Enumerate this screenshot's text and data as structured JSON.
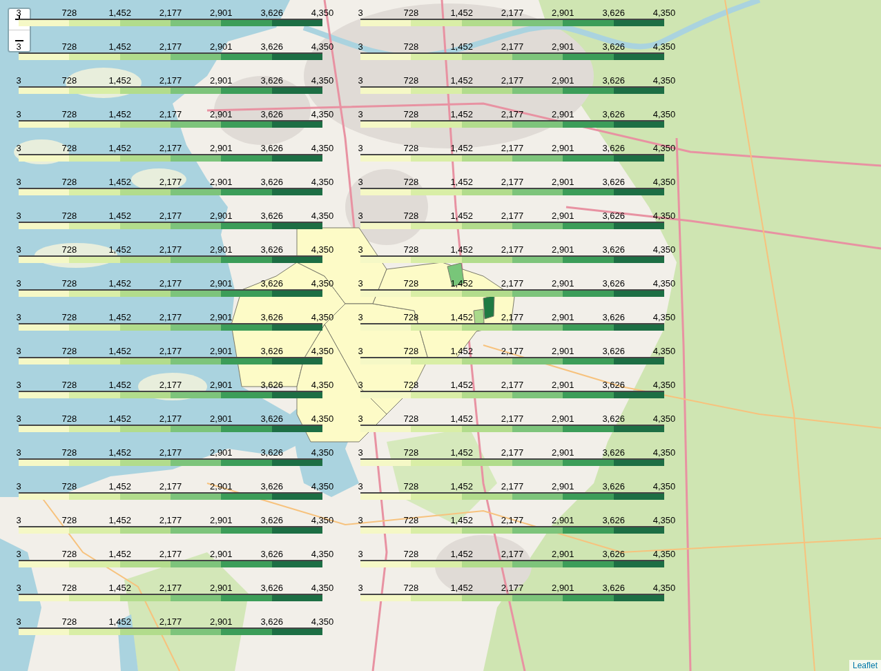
{
  "map": {
    "districts": [
      {
        "color": "#fdfbc7"
      },
      {
        "color": "#fdfbc7"
      },
      {
        "color": "#fdfbc7"
      },
      {
        "color": "#fdfbc7"
      },
      {
        "color": "#fdfbc7"
      },
      {
        "color": "#78c679"
      },
      {
        "color": "#1f7a43"
      },
      {
        "color": "#a9d98b"
      }
    ]
  },
  "zoom_control": {
    "buttons": [
      {
        "kind": "zoom_in"
      },
      {
        "kind": "zoom_out"
      }
    ]
  },
  "scale_segments": [
    {
      "color": "#f5f8c6"
    },
    {
      "color": "#d9eea6"
    },
    {
      "color": "#b2dc8c"
    },
    {
      "color": "#7dc47b"
    },
    {
      "color": "#3c9d59"
    },
    {
      "color": "#1d6e44"
    }
  ],
  "legend_columns": [
    {
      "legends": [
        {
          "ticks": [
            "3",
            "728",
            "1,452",
            "2,177",
            "2,901",
            "3,626",
            "4,350"
          ]
        },
        {
          "ticks": [
            "3",
            "728",
            "1,452",
            "2,177",
            "2,901",
            "3,626",
            "4,350"
          ]
        },
        {
          "ticks": [
            "3",
            "728",
            "1,452",
            "2,177",
            "2,901",
            "3,626",
            "4,350"
          ]
        },
        {
          "ticks": [
            "3",
            "728",
            "1,452",
            "2,177",
            "2,901",
            "3,626",
            "4,350"
          ]
        },
        {
          "ticks": [
            "3",
            "728",
            "1,452",
            "2,177",
            "2,901",
            "3,626",
            "4,350"
          ]
        },
        {
          "ticks": [
            "3",
            "728",
            "1,452",
            "2,177",
            "2,901",
            "3,626",
            "4,350"
          ]
        },
        {
          "ticks": [
            "3",
            "728",
            "1,452",
            "2,177",
            "2,901",
            "3,626",
            "4,350"
          ]
        },
        {
          "ticks": [
            "3",
            "728",
            "1,452",
            "2,177",
            "2,901",
            "3,626",
            "4,350"
          ]
        },
        {
          "ticks": [
            "3",
            "728",
            "1,452",
            "2,177",
            "2,901",
            "3,626",
            "4,350"
          ]
        },
        {
          "ticks": [
            "3",
            "728",
            "1,452",
            "2,177",
            "2,901",
            "3,626",
            "4,350"
          ]
        },
        {
          "ticks": [
            "3",
            "728",
            "1,452",
            "2,177",
            "2,901",
            "3,626",
            "4,350"
          ]
        },
        {
          "ticks": [
            "3",
            "728",
            "1,452",
            "2,177",
            "2,901",
            "3,626",
            "4,350"
          ]
        },
        {
          "ticks": [
            "3",
            "728",
            "1,452",
            "2,177",
            "2,901",
            "3,626",
            "4,350"
          ]
        },
        {
          "ticks": [
            "3",
            "728",
            "1,452",
            "2,177",
            "2,901",
            "3,626",
            "4,350"
          ]
        },
        {
          "ticks": [
            "3",
            "728",
            "1,452",
            "2,177",
            "2,901",
            "3,626",
            "4,350"
          ]
        },
        {
          "ticks": [
            "3",
            "728",
            "1,452",
            "2,177",
            "2,901",
            "3,626",
            "4,350"
          ]
        },
        {
          "ticks": [
            "3",
            "728",
            "1,452",
            "2,177",
            "2,901",
            "3,626",
            "4,350"
          ]
        },
        {
          "ticks": [
            "3",
            "728",
            "1,452",
            "2,177",
            "2,901",
            "3,626",
            "4,350"
          ]
        },
        {
          "ticks": [
            "3",
            "728",
            "1,452",
            "2,177",
            "2,901",
            "3,626",
            "4,350"
          ]
        }
      ]
    },
    {
      "legends": [
        {
          "ticks": [
            "3",
            "728",
            "1,452",
            "2,177",
            "2,901",
            "3,626",
            "4,350"
          ]
        },
        {
          "ticks": [
            "3",
            "728",
            "1,452",
            "2,177",
            "2,901",
            "3,626",
            "4,350"
          ]
        },
        {
          "ticks": [
            "3",
            "728",
            "1,452",
            "2,177",
            "2,901",
            "3,626",
            "4,350"
          ]
        },
        {
          "ticks": [
            "3",
            "728",
            "1,452",
            "2,177",
            "2,901",
            "3,626",
            "4,350"
          ]
        },
        {
          "ticks": [
            "3",
            "728",
            "1,452",
            "2,177",
            "2,901",
            "3,626",
            "4,350"
          ]
        },
        {
          "ticks": [
            "3",
            "728",
            "1,452",
            "2,177",
            "2,901",
            "3,626",
            "4,350"
          ]
        },
        {
          "ticks": [
            "3",
            "728",
            "1,452",
            "2,177",
            "2,901",
            "3,626",
            "4,350"
          ]
        },
        {
          "ticks": [
            "3",
            "728",
            "1,452",
            "2,177",
            "2,901",
            "3,626",
            "4,350"
          ]
        },
        {
          "ticks": [
            "3",
            "728",
            "1,452",
            "2,177",
            "2,901",
            "3,626",
            "4,350"
          ]
        },
        {
          "ticks": [
            "3",
            "728",
            "1,452",
            "2,177",
            "2,901",
            "3,626",
            "4,350"
          ]
        },
        {
          "ticks": [
            "3",
            "728",
            "1,452",
            "2,177",
            "2,901",
            "3,626",
            "4,350"
          ]
        },
        {
          "ticks": [
            "3",
            "728",
            "1,452",
            "2,177",
            "2,901",
            "3,626",
            "4,350"
          ]
        },
        {
          "ticks": [
            "3",
            "728",
            "1,452",
            "2,177",
            "2,901",
            "3,626",
            "4,350"
          ]
        },
        {
          "ticks": [
            "3",
            "728",
            "1,452",
            "2,177",
            "2,901",
            "3,626",
            "4,350"
          ]
        },
        {
          "ticks": [
            "3",
            "728",
            "1,452",
            "2,177",
            "2,901",
            "3,626",
            "4,350"
          ]
        },
        {
          "ticks": [
            "3",
            "728",
            "1,452",
            "2,177",
            "2,901",
            "3,626",
            "4,350"
          ]
        },
        {
          "ticks": [
            "3",
            "728",
            "1,452",
            "2,177",
            "2,901",
            "3,626",
            "4,350"
          ]
        },
        {
          "ticks": [
            "3",
            "728",
            "1,452",
            "2,177",
            "2,901",
            "3,626",
            "4,350"
          ]
        }
      ]
    }
  ],
  "attribution": {
    "link": "Leaflet"
  }
}
